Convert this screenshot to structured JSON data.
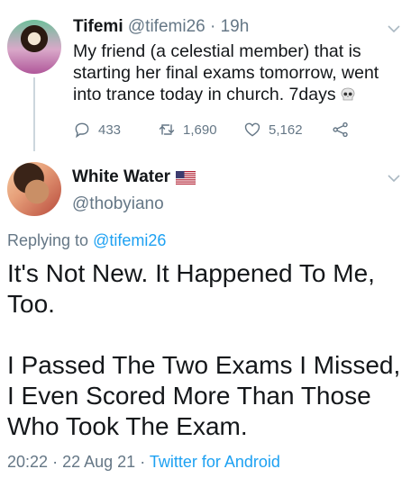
{
  "parent": {
    "name": "Tifemi",
    "handle": "@tifemi26",
    "separator": "·",
    "time": "19h",
    "text": "My friend (a celestial member) that is starting her final exams tomorrow, went into trance today in church. 7days",
    "emoji_icon": "skull-icon",
    "actions": {
      "replies": "433",
      "retweets": "1,690",
      "likes": "5,162"
    }
  },
  "reply": {
    "name": "White Water",
    "flag_icon": "us-flag-icon",
    "handle": "@thobyiano",
    "replying_prefix": "Replying to",
    "replying_to": "@tifemi26",
    "paragraph1": "It's Not New. It Happened To Me, Too.",
    "paragraph2": "I Passed The Two Exams I Missed, I Even Scored More Than Those Who Took The Exam.",
    "time": "20:22",
    "date": "22 Aug 21",
    "separator": "·",
    "source": "Twitter for Android"
  },
  "colors": {
    "text": "#14171a",
    "secondary": "#657786",
    "link": "#1da1f2",
    "thread_line": "#ccd6dd"
  }
}
